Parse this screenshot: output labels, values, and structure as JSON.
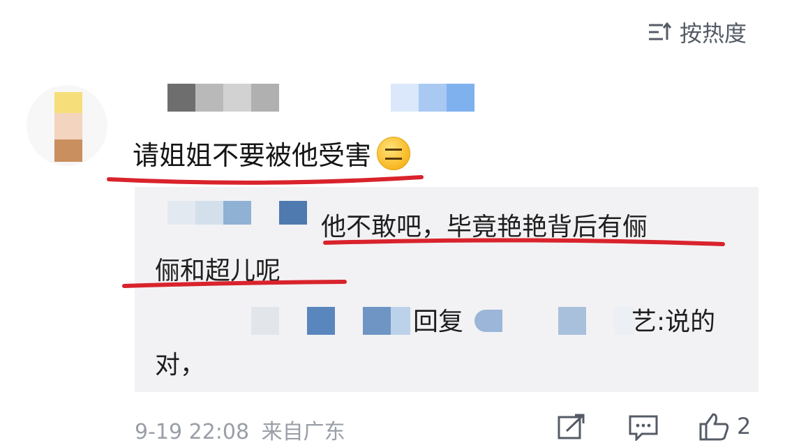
{
  "header": {
    "sort_label": "按热度",
    "sort_icon": "sort-icon"
  },
  "comment": {
    "text": "请姐姐不要被他受害",
    "emoji": "expressionless-face-icon",
    "reply": {
      "text_line1": "他不敢吧，毕竟艳艳背后有俪",
      "text_line2": "俪和超儿呢",
      "subreply_prefix": "回复",
      "subreply_suffix": "艺:说的",
      "subreply_line2": "对，"
    },
    "meta": {
      "timestamp": "9-19 22:08",
      "location": "来自广东"
    },
    "actions": {
      "share_icon": "share-icon",
      "comment_icon": "comment-icon",
      "like_icon": "like-icon",
      "like_count": "2"
    }
  },
  "colors": {
    "highlight": "#d9232c",
    "reply_bg": "#f2f2f4",
    "meta_text": "#9a9ea6"
  }
}
